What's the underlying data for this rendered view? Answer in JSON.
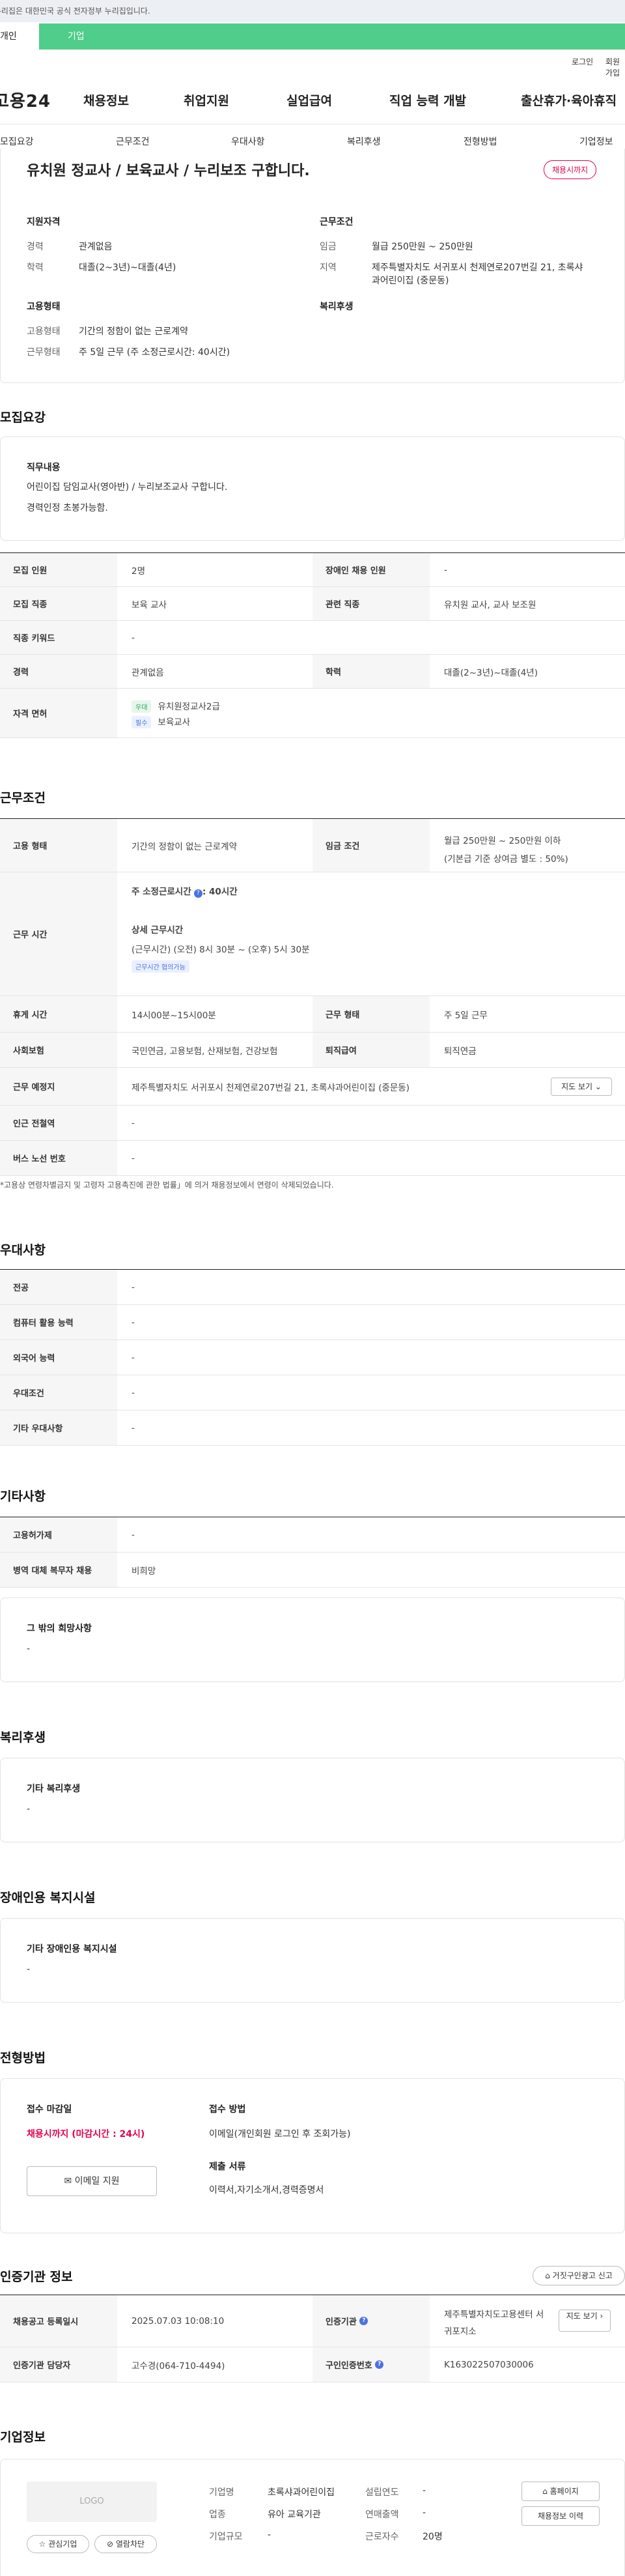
{
  "gov_banner": "이 누리집은 대한민국 공식 전자정부 누리집입니다.",
  "tabs": [
    "개인",
    "기업"
  ],
  "util": {
    "login": "로그인",
    "join": "회원가입"
  },
  "logo": "고용24",
  "gnb": [
    "채용정보",
    "취업지원",
    "실업급여",
    "직업 능력 개발",
    "출산휴가·육아휴직"
  ],
  "subnav": [
    "모집요강",
    "근무조건",
    "우대사항",
    "복리후생",
    "전형방법",
    "기업정보"
  ],
  "summary": {
    "title": "유치원 정교사 / 보육교사 / 누리보조 구합니다.",
    "badge": "채용시까지",
    "qual_h": "지원자격",
    "exp_l": "경력",
    "exp_v": "관계없음",
    "edu_l": "학력",
    "edu_v": "대졸(2~3년)~대졸(4년)",
    "cond_h": "근무조건",
    "pay_l": "임금",
    "pay_v": "월급 250만원 ~ 250만원",
    "loc_l": "지역",
    "loc_v1": "제주특별자치도 서귀포시 천제연로207번길 21, 초록샤",
    "loc_v2": "과어린이집 (중문동)",
    "emp_h": "고용형태",
    "type_l": "고용형태",
    "type_v": "기간의 정함이 없는 근로계약",
    "form_l": "근무형태",
    "form_v": "주 5일 근무 (주 소정근로시간: 40시간)",
    "welfare_h": "복리후생"
  },
  "recruit": {
    "h": "모집요강",
    "job_h": "직무내용",
    "job_v1": "어린이집 담임교사(영아반)  / 누리보조교사 구합니다.",
    "job_v2": "경력인정 초봉가능함.",
    "rows": {
      "count_l": "모집 인원",
      "count_v": "2명",
      "dis_l": "장애인 채용 인원",
      "dis_v": "-",
      "job_l": "모집 직종",
      "job_v": "보육 교사",
      "rel_l": "관련 직종",
      "rel_v": "유치원 교사, 교사 보조원",
      "kw_l": "직종 키워드",
      "kw_v": "-",
      "exp_l": "경력",
      "exp_v": "관계없음",
      "edu_l": "학력",
      "edu_v": "대졸(2~3년)~대졸(4년)",
      "lic_l": "자격 면허",
      "lic_tag1": "우대",
      "lic_v1": "유치원정교사2급",
      "lic_tag2": "필수",
      "lic_v2": "보육교사"
    }
  },
  "work": {
    "h": "근무조건",
    "type_l": "고용 형태",
    "type_v": "기간의 정함이 없는 근로계약",
    "pay_l": "임금 조건",
    "pay_v1": "월급 250만원 ~ 250만원 이하",
    "pay_v2": "(기본급 기준 상여금 별도 : 50%)",
    "hours_l": "근무 시간",
    "hours_t": "주 소정근로시간",
    "hours_v": ": 40시간",
    "detail_t": "상세 근무시간",
    "detail_v": "(근무시간) (오전) 8시 30분 ~ (오후) 5시 30분",
    "flex": "근무시간 협의가능",
    "break_l": "휴게 시간",
    "break_v": "14시00분~15시00분",
    "form_l": "근무 형태",
    "form_v": "주 5일 근무",
    "ins_l": "사회보험",
    "ins_v": "국민연금, 고용보험, 산재보험, 건강보험",
    "ret_l": "퇴직급여",
    "ret_v": "퇴직연금",
    "addr_l": "근무 예정지",
    "addr_v": "제주특별자치도 서귀포시 천제연로207번길 21, 초록샤과어린이집 (중문동)",
    "map_btn": "지도 보기",
    "sub_l": "인근 전철역",
    "sub_v": "-",
    "bus_l": "버스 노선 번호",
    "bus_v": "-",
    "note": "*고용상 연령차별금지 및 고령자 고용촉진에 관한 법률」에 의거 채용정보에서 연령이 삭제되었습니다."
  },
  "pref": {
    "h": "우대사항",
    "rows": [
      [
        "전공",
        "-"
      ],
      [
        "컴퓨터 활용 능력",
        "-"
      ],
      [
        "외국어 능력",
        "-"
      ],
      [
        "우대조건",
        "-"
      ],
      [
        "기타 우대사항",
        "-"
      ]
    ]
  },
  "etc": {
    "h": "기타사항",
    "rows": [
      [
        "고용허가제",
        "-"
      ],
      [
        "병역 대체 복무자 채용",
        "비희망"
      ]
    ],
    "hope_h": "그 밖의 희망사항",
    "hope_v": "-"
  },
  "welfare": {
    "h": "복리후생",
    "box_h": "기타 복리후생",
    "box_v": "-"
  },
  "disab": {
    "h": "장애인용 복지시설",
    "box_h": "기타 장애인용 복지시설",
    "box_v": "-"
  },
  "select": {
    "h": "전형방법",
    "deadline_h": "접수 마감일",
    "deadline_v": "채용시까지 (마감시간 : 24시)",
    "apply_btn": "이메일 지원",
    "method_h": "접수 방법",
    "method_v": "이메일(개인회원 로그인 후 조회가능)",
    "docs_h": "제출 서류",
    "docs_v": "이력서,자기소개서,경력증명서"
  },
  "cert": {
    "h": "인증기관 정보",
    "report_btn": "거짓구인광고 신고",
    "reg_l": "채용공고 등록일시",
    "reg_v": "2025.07.03 10:08:10",
    "org_l": "인증기관",
    "org_v1": "제주특별자치도고용센터 서",
    "org_v2": "귀포지소",
    "map_btn": "지도 보기",
    "mgr_l": "인증기관 담당자",
    "mgr_v": "고수경(064-710-4494)",
    "no_l": "구인인증번호",
    "no_v": "K163022507030006"
  },
  "company": {
    "h": "기업정보",
    "logo": "LOGO",
    "fav_btn": "관심기업",
    "block_btn": "열람차단",
    "name_l": "기업명",
    "name_v": "초록샤과어린이집",
    "ind_l": "업종",
    "ind_v": "유아 교육기관",
    "size_l": "기업규모",
    "size_v": "-",
    "est_l": "설립연도",
    "est_v": "-",
    "sales_l": "연매출액",
    "sales_v": "-",
    "emp_l": "근로자수",
    "emp_v": "20명",
    "home_btn": "홈페이지",
    "hist_btn": "채용정보 이력"
  }
}
